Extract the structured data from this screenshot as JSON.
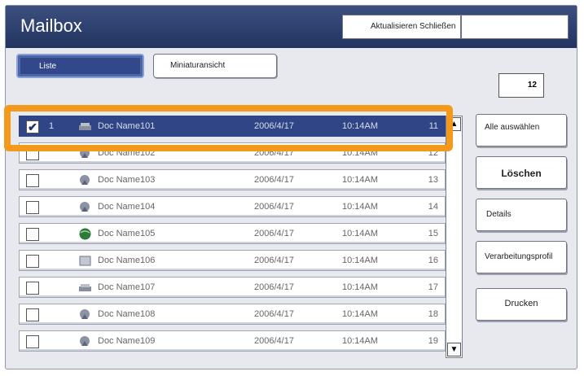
{
  "window": {
    "title": "Mailbox"
  },
  "top_buttons": {
    "refresh_label": "Aktualisieren Schließen",
    "extra_label": ""
  },
  "view_tabs": {
    "list_label": "Liste",
    "thumbnail_label": "Miniaturansicht"
  },
  "document_count": "12",
  "documents": [
    {
      "checked": true,
      "index": "1",
      "name": "Doc Name101",
      "date": "2006/4/17",
      "time": "10:14AM",
      "number": "11",
      "icon": "scanner-icon"
    },
    {
      "checked": false,
      "index": "",
      "name": "Doc Name102",
      "date": "2006/4/17",
      "time": "10:14AM",
      "number": "12",
      "icon": "document-icon"
    },
    {
      "checked": false,
      "index": "",
      "name": "Doc Name103",
      "date": "2006/4/17",
      "time": "10:14AM",
      "number": "13",
      "icon": "document-icon"
    },
    {
      "checked": false,
      "index": "",
      "name": "Doc Name104",
      "date": "2006/4/17",
      "time": "10:14AM",
      "number": "14",
      "icon": "document-icon"
    },
    {
      "checked": false,
      "index": "",
      "name": "Doc Name105",
      "date": "2006/4/17",
      "time": "10:14AM",
      "number": "15",
      "icon": "globe-icon"
    },
    {
      "checked": false,
      "index": "",
      "name": "Doc Name106",
      "date": "2006/4/17",
      "time": "10:14AM",
      "number": "16",
      "icon": "box-icon"
    },
    {
      "checked": false,
      "index": "",
      "name": "Doc Name107",
      "date": "2006/4/17",
      "time": "10:14AM",
      "number": "17",
      "icon": "scanner-icon"
    },
    {
      "checked": false,
      "index": "",
      "name": "Doc Name108",
      "date": "2006/4/17",
      "time": "10:14AM",
      "number": "18",
      "icon": "document-icon"
    },
    {
      "checked": false,
      "index": "",
      "name": "Doc Name109",
      "date": "2006/4/17",
      "time": "10:14AM",
      "number": "19",
      "icon": "document-icon"
    }
  ],
  "actions": {
    "select_all_label": "Alle auswählen",
    "delete_label": "Löschen",
    "details_label": "Details",
    "processing_profile_label": "Verarbeitungsprofil",
    "print_label": "Drucken"
  },
  "colors": {
    "accent": "#2f4585",
    "highlight": "#f39a1c",
    "title_bar": "#2b3d6b"
  }
}
